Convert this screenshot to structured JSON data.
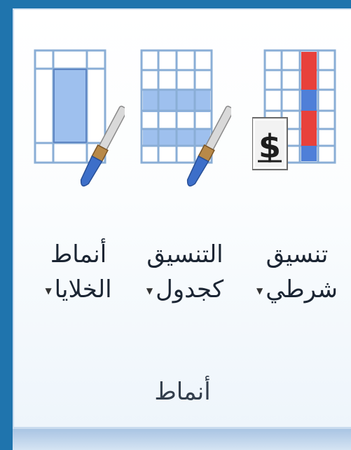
{
  "group": {
    "title": "أنماط"
  },
  "buttons": [
    {
      "id": "cell-styles",
      "line1": "أنماط",
      "line2": "الخلايا",
      "icon": "cell-styles-icon"
    },
    {
      "id": "format-as-table",
      "line1": "التنسيق",
      "line2": "كجدول",
      "icon": "format-as-table-icon"
    },
    {
      "id": "conditional-formatting",
      "line1": "تنسيق",
      "line2": "شرطي",
      "icon": "conditional-formatting-icon"
    }
  ],
  "dropdown_glyph": "▼",
  "colors": {
    "background": "#1f74ad",
    "grid_line": "#8aaed6",
    "cell_blue": "#9ec0ee",
    "highlight_red": "#e8413b",
    "highlight_blue": "#4f7fd8"
  }
}
